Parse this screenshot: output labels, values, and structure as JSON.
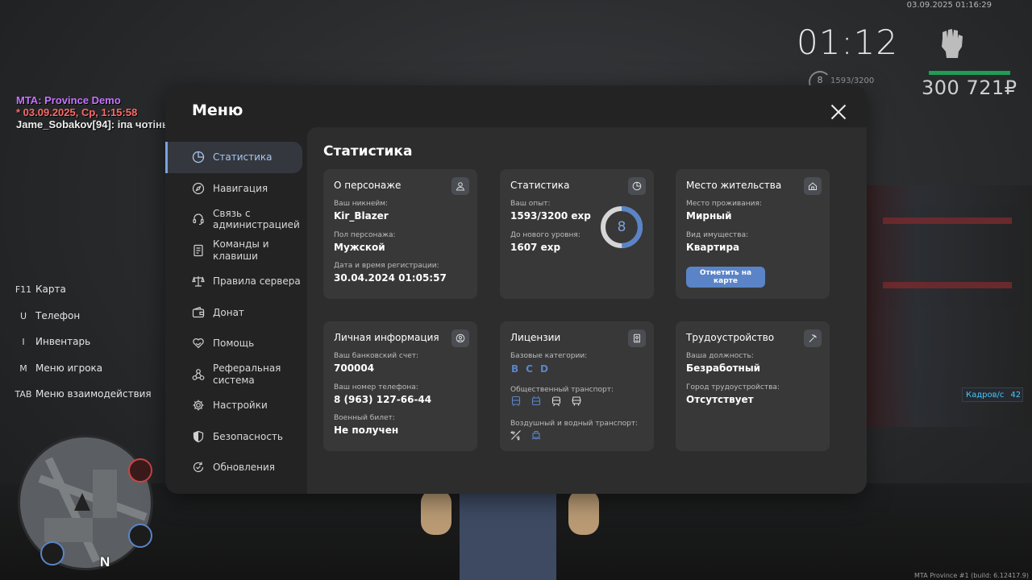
{
  "hud": {
    "datetime": "03.09.2025 01:16:29",
    "time": "01:12",
    "level": "8",
    "exp": "1593/3200",
    "money": "300 721₽",
    "fps_label": "Кадров/с",
    "fps_value": "42",
    "build": "MTA Province #1 (build: 6.12417.9)"
  },
  "chat": {
    "line1": "MTA: Province Demo",
    "line2": "* 03.09.2025, Ср, 1:15:58",
    "line3": "Jame_Sobakov[94]: іпа чотінько"
  },
  "hotkeys": [
    {
      "key": "F11",
      "label": "Карта"
    },
    {
      "key": "U",
      "label": "Телефон"
    },
    {
      "key": "I",
      "label": "Инвентарь"
    },
    {
      "key": "M",
      "label": "Меню игрока"
    },
    {
      "key": "TAB",
      "label": "Меню взаимодействия"
    }
  ],
  "minimap": {
    "north": "N"
  },
  "menu": {
    "title": "Меню",
    "nav": [
      {
        "label": "Статистика",
        "icon": "pie-chart-icon"
      },
      {
        "label": "Навигация",
        "icon": "compass-icon"
      },
      {
        "label": "Связь с администрацией",
        "icon": "headset-icon"
      },
      {
        "label": "Команды и клавиши",
        "icon": "document-icon"
      },
      {
        "label": "Правила сервера",
        "icon": "scales-icon"
      },
      {
        "label": "Донат",
        "icon": "wallet-icon"
      },
      {
        "label": "Помощь",
        "icon": "heart-hand-icon"
      },
      {
        "label": "Реферальная система",
        "icon": "network-icon"
      },
      {
        "label": "Настройки",
        "icon": "gear-icon"
      },
      {
        "label": "Безопасность",
        "icon": "shield-icon"
      },
      {
        "label": "Обновления",
        "icon": "refresh-icon"
      }
    ],
    "active_index": 0
  },
  "stats": {
    "title": "Статистика",
    "character": {
      "title": "О персонаже",
      "nickname_label": "Ваш никнейм:",
      "nickname": "Kir_Blazer",
      "gender_label": "Пол персонажа:",
      "gender": "Мужской",
      "reg_label": "Дата и время регистрации:",
      "reg_date": "30.04.2024 01:05:57"
    },
    "statistics": {
      "title": "Статистика",
      "exp_label": "Ваш опыт:",
      "exp": "1593/3200 exp",
      "next_label": "До нового уровня:",
      "next": "1607 exp",
      "level": "8",
      "progress": 0.4978
    },
    "residence": {
      "title": "Место жительства",
      "place_label": "Место проживания:",
      "place": "Мирный",
      "property_label": "Вид имущества:",
      "property": "Квартира",
      "button": "Отметить на карте"
    },
    "personal": {
      "title": "Личная информация",
      "bank_label": "Ваш банковский счет:",
      "bank": "700004",
      "phone_label": "Ваш номер телефона:",
      "phone": "8 (963) 127-66-44",
      "military_label": "Военный билет:",
      "military": "Не получен"
    },
    "licenses": {
      "title": "Лицензии",
      "basic_label": "Базовые категории:",
      "categories": [
        "B",
        "C",
        "D"
      ],
      "public_label": "Общественный транспорт:",
      "air_label": "Воздушный и водный транспорт:"
    },
    "employment": {
      "title": "Трудоустройство",
      "position_label": "Ваша должность:",
      "position": "Безработный",
      "city_label": "Город трудоустройства:",
      "city": "Отсутствует"
    }
  },
  "colors": {
    "accent": "#5a84c7",
    "active_nav": "#a9c4ee",
    "money_bar": "#1f9d55"
  }
}
